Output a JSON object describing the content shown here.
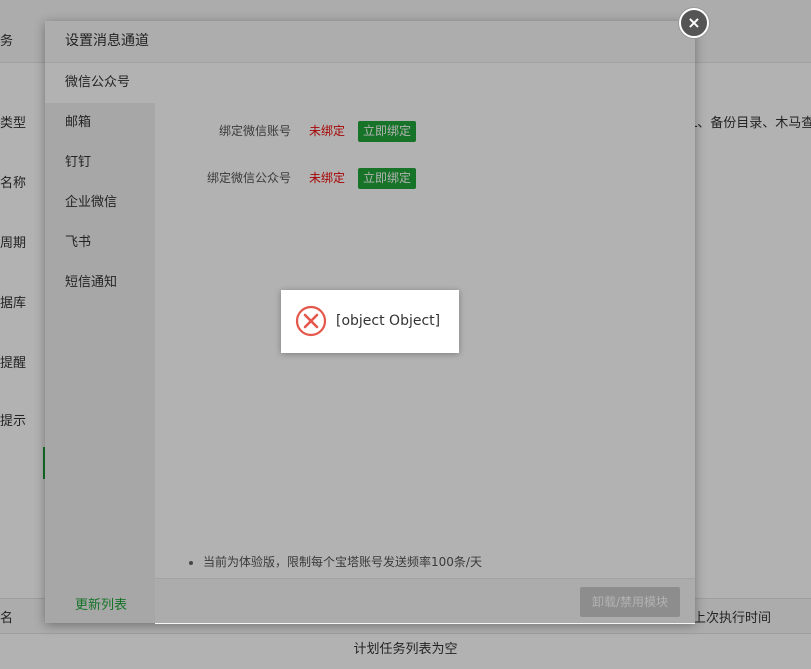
{
  "background": {
    "side_labels": [
      "务",
      "类型",
      "名称",
      "周期",
      "据库",
      "提醒",
      "提示"
    ],
    "right_text": "L、备份目录、木马查杀",
    "table_headers": [
      "名",
      "上次执行时间"
    ],
    "empty_text": "计划任务列表为空"
  },
  "modal": {
    "title": "设置消息通道",
    "close_label": "×",
    "sidebar": {
      "items": [
        {
          "label": "微信公众号",
          "active": true
        },
        {
          "label": "邮箱"
        },
        {
          "label": "钉钉"
        },
        {
          "label": "企业微信"
        },
        {
          "label": "飞书"
        },
        {
          "label": "短信通知"
        }
      ],
      "refresh_label": "更新列表"
    },
    "bindings": [
      {
        "label": "绑定微信账号",
        "status": "未绑定",
        "button": "立即绑定"
      },
      {
        "label": "绑定微信公众号",
        "status": "未绑定",
        "button": "立即绑定"
      }
    ],
    "tip": "当前为体验版，限制每个宝塔账号发送频率100条/天",
    "footer_button": "卸载/禁用模块"
  },
  "toast": {
    "icon": "error-circle-icon",
    "message": "[object Object]",
    "color": "#e5574a"
  }
}
